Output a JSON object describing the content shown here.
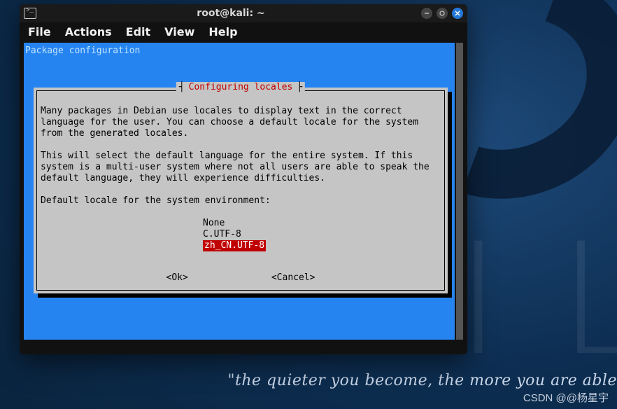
{
  "desktop": {
    "kali_text": "KALI LINU",
    "tagline": "\"the quieter you become, the more you are able",
    "watermark": "CSDN @@杨星宇"
  },
  "window": {
    "title": "root@kali: ~",
    "menu": {
      "file": "File",
      "actions": "Actions",
      "edit": "Edit",
      "view": "View",
      "help": "Help"
    }
  },
  "terminal": {
    "header": "Package configuration",
    "dialog_title": "Configuring locales",
    "body_para1": "Many packages in Debian use locales to display text in the correct language for the user. You can choose a default locale for the system from the generated locales.",
    "body_para2": "This will select the default language for the entire system. If this system is a multi-user system where not all users are able to speak the default language, they will experience difficulties.",
    "prompt": "Default locale for the system environment:",
    "options": {
      "o0": "None",
      "o1": "C.UTF-8",
      "o2": "zh_CN.UTF-8"
    },
    "selected_index": 2,
    "buttons": {
      "ok": "<Ok>",
      "cancel": "<Cancel>"
    }
  }
}
